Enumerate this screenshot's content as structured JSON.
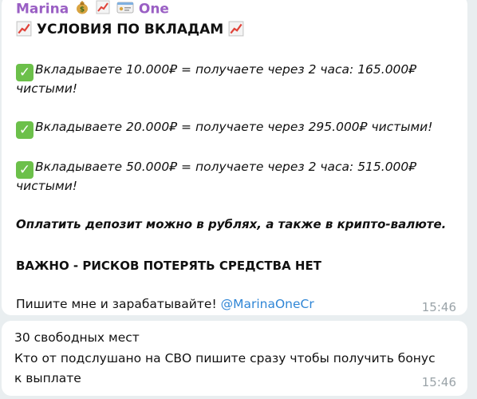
{
  "message_1": {
    "sender": "Marina",
    "sender_suffix": "One",
    "sender_emojis": [
      "money-bag-icon",
      "chart-up-icon",
      "id-card-icon"
    ],
    "heading": "УСЛОВИЯ ПО ВКЛАДАМ",
    "offers": [
      {
        "line1": "Вкладываете 10.000₽ = получаете через 2 часа: 165.000₽",
        "line2": "чистыми!"
      },
      {
        "line1": "Вкладываете 20.000₽ = получаете через 295.000₽ чистыми!",
        "line2": ""
      },
      {
        "line1": "Вкладываете 50.000₽ =  получаете через 2 часа: 515.000₽",
        "line2": "чистыми!"
      }
    ],
    "payment_note": "Оплатить депозит можно в рублях, а также в крипто-валюте.",
    "risk_note": "ВАЖНО - РИСКОВ ПОТЕРЯТЬ СРЕДСТВА НЕТ",
    "contact_text": "Пишите мне и зарабатывайте! ",
    "contact_mention": "@MarinaOneCr",
    "time": "15:46"
  },
  "message_2": {
    "line1": "30 свободных мест",
    "line2": "Кто от подслушано на СВО пишите сразу чтобы получить бонус",
    "line3": "к выплате",
    "time": "15:46"
  },
  "colors": {
    "sender": "#9a5fc4",
    "mention": "#2f86d6",
    "timestamp": "#9aa3a8",
    "check": "#6cc04a",
    "background": "#e9eef0"
  }
}
